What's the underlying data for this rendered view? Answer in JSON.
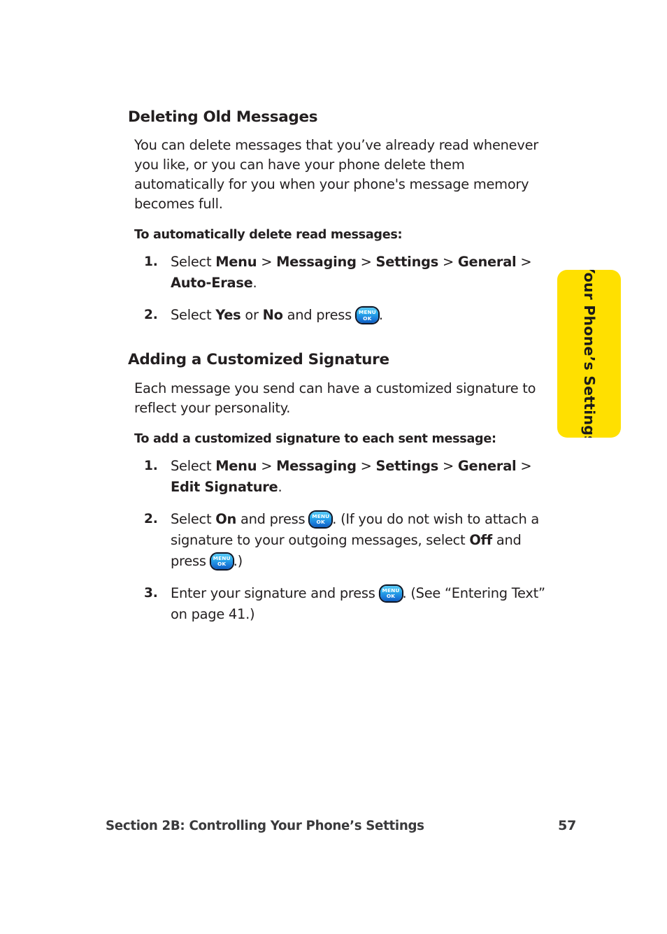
{
  "page": {
    "side_tab_label": "Your Phone’s Settings",
    "side_tab_color": "#ffe000"
  },
  "sections": [
    {
      "heading": "Deleting Old Messages",
      "paragraph": "You can delete messages that you’ve already read whenever you like, or you can have your phone delete them automatically for you when your phone's message memory becomes full.",
      "lead_in": "To automatically delete read messages:",
      "steps": [
        {
          "number": "1.",
          "parts": [
            {
              "type": "text",
              "value": "Select "
            },
            {
              "type": "bold",
              "value": "Menu"
            },
            {
              "type": "text",
              "value": " > "
            },
            {
              "type": "bold",
              "value": "Messaging"
            },
            {
              "type": "text",
              "value": " > "
            },
            {
              "type": "bold",
              "value": "Settings"
            },
            {
              "type": "text",
              "value": " > "
            },
            {
              "type": "bold",
              "value": "General"
            },
            {
              "type": "text",
              "value": " > "
            },
            {
              "type": "bold",
              "value": "Auto-Erase"
            },
            {
              "type": "text",
              "value": "."
            }
          ]
        },
        {
          "number": "2.",
          "parts": [
            {
              "type": "text",
              "value": "Select "
            },
            {
              "type": "bold",
              "value": "Yes"
            },
            {
              "type": "text",
              "value": " or "
            },
            {
              "type": "bold",
              "value": "No"
            },
            {
              "type": "text",
              "value": " and press "
            },
            {
              "type": "key",
              "value": "menu-ok-key"
            },
            {
              "type": "text",
              "value": "."
            }
          ]
        }
      ]
    },
    {
      "heading": "Adding a Customized Signature",
      "paragraph": "Each message you send can have a customized signature to reflect your personality.",
      "lead_in": "To add a customized signature to each sent message:",
      "steps": [
        {
          "number": "1.",
          "parts": [
            {
              "type": "text",
              "value": "Select "
            },
            {
              "type": "bold",
              "value": "Menu"
            },
            {
              "type": "text",
              "value": " > "
            },
            {
              "type": "bold",
              "value": "Messaging"
            },
            {
              "type": "text",
              "value": " > "
            },
            {
              "type": "bold",
              "value": "Settings"
            },
            {
              "type": "text",
              "value": " > "
            },
            {
              "type": "bold",
              "value": "General"
            },
            {
              "type": "text",
              "value": " > "
            },
            {
              "type": "bold",
              "value": "Edit Signature"
            },
            {
              "type": "text",
              "value": "."
            }
          ]
        },
        {
          "number": "2.",
          "parts": [
            {
              "type": "text",
              "value": "Select "
            },
            {
              "type": "bold",
              "value": "On"
            },
            {
              "type": "text",
              "value": " and press "
            },
            {
              "type": "key",
              "value": "menu-ok-key"
            },
            {
              "type": "text",
              "value": ". (If you do not wish to attach a signature to your outgoing messages, select "
            },
            {
              "type": "bold",
              "value": "Off"
            },
            {
              "type": "text",
              "value": " and press "
            },
            {
              "type": "key",
              "value": "menu-ok-key"
            },
            {
              "type": "text",
              "value": ".)"
            }
          ]
        },
        {
          "number": "3.",
          "parts": [
            {
              "type": "text",
              "value": "Enter your signature and press "
            },
            {
              "type": "key",
              "value": "menu-ok-key"
            },
            {
              "type": "text",
              "value": ". (See “Entering Text” on page 41.)"
            }
          ]
        }
      ]
    }
  ],
  "menu_ok_key": {
    "line1": "MENU",
    "line2": "OK",
    "gradient_top": "#5ec8f5",
    "gradient_bottom": "#1060c0",
    "border": "#111827",
    "text_color": "#ffffff"
  },
  "footer": {
    "section_label": "Section 2B: Controlling Your Phone’s Settings",
    "page_number": "57"
  }
}
